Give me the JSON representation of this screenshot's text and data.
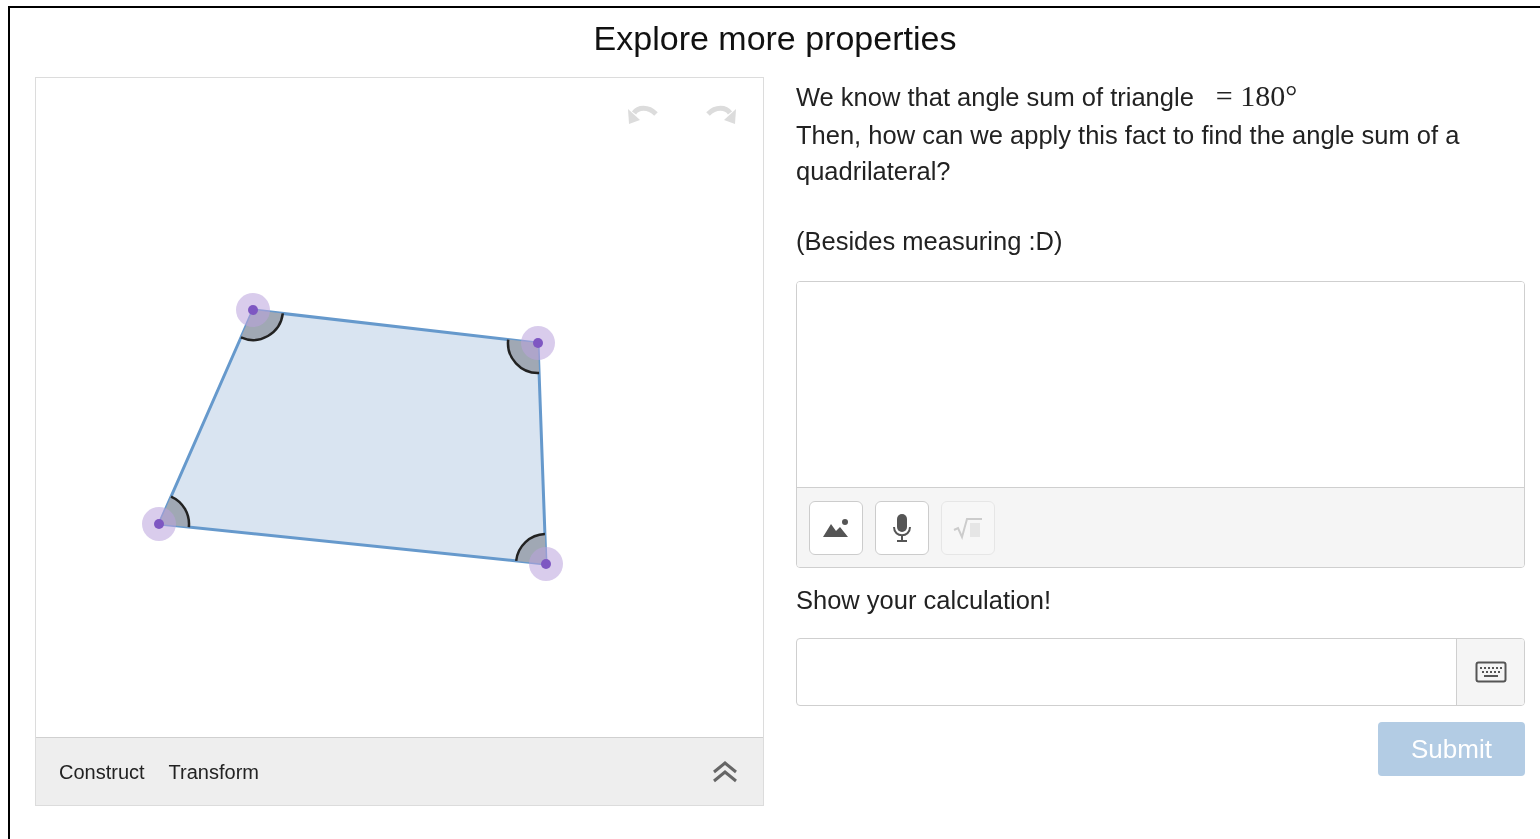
{
  "title": "Explore more properties",
  "geometry": {
    "undo": {
      "disabled": true
    },
    "redo": {
      "disabled": true
    },
    "tabs": [
      {
        "label": "Construct",
        "selected": false
      },
      {
        "label": "Transform",
        "selected": false
      }
    ],
    "toolbar_expanded": false
  },
  "question": {
    "line_1": "We know that angle sum of triangle",
    "math": "= 180°",
    "line_2": "Then, how can we apply this fact to find the angle sum of a quadrilateral?",
    "note": "(Besides measuring :D)"
  },
  "answer_tools": [
    {
      "kind": "image",
      "disabled": false
    },
    {
      "kind": "microphone",
      "disabled": false
    },
    {
      "kind": "math",
      "disabled": true
    }
  ],
  "calculation": {
    "label": "Show your calculation!"
  },
  "submit": {
    "label": "Submit",
    "disabled": true
  }
}
